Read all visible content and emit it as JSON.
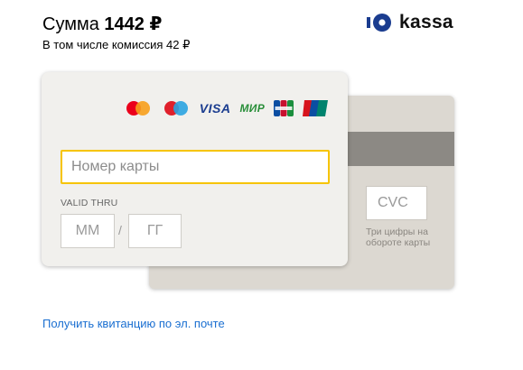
{
  "payment": {
    "sum_label": "Сумма",
    "amount": "1442",
    "currency": "₽",
    "commission_text": "В том числе комиссия 42 ₽"
  },
  "brand": {
    "logo_text": "kassa",
    "logo_color": "#1a3c8f"
  },
  "card_front": {
    "brands": [
      "mastercard-icon",
      "maestro-icon",
      "VISA",
      "МИР",
      "jcb-icon",
      "unionpay-icon"
    ],
    "visa_label": "VISA",
    "mir_label": "МИР",
    "number_placeholder": "Номер карты",
    "valid_thru_label": "VALID THRU",
    "month_placeholder": "ММ",
    "year_placeholder": "ГГ",
    "separator": "/",
    "focus_color": "#f6c400"
  },
  "card_back": {
    "cvc_placeholder": "CVC",
    "cvc_hint": "Три цифры на обороте карты"
  },
  "receipt_link": "Получить квитанцию по эл. почте",
  "colors": {
    "link": "#1a6fd1",
    "card_front_bg": "#f1f0ed",
    "card_back_bg": "#dcd8d1",
    "magstripe": "#8c8984"
  }
}
